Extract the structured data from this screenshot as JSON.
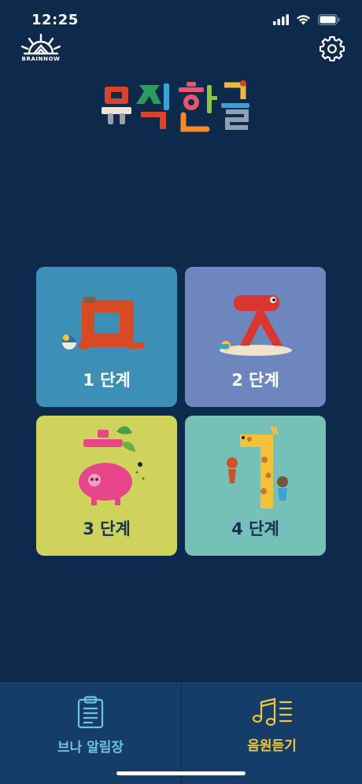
{
  "status_bar": {
    "time": "12:25",
    "icons": [
      "signal-icon",
      "wifi-icon",
      "battery-icon"
    ]
  },
  "header": {
    "brand_name": "BRAINNOW",
    "settings_icon": "gear-icon"
  },
  "app_logo": {
    "title": "뮤직한글",
    "letters": [
      {
        "char": "뮤",
        "color": "#d9432b"
      },
      {
        "char": "직",
        "color": "#2d9a5f"
      },
      {
        "char": "한",
        "color": "#e8566e"
      },
      {
        "char": "글",
        "color": "#f1b93a"
      }
    ]
  },
  "levels": [
    {
      "label": "1 단계",
      "color": "#3e8fb6",
      "art_letter": "ㅁ"
    },
    {
      "label": "2 단계",
      "color": "#6e86be",
      "art_letter": "ㅈ"
    },
    {
      "label": "3 단계",
      "color": "#cdd35b",
      "art_letter": "ㅎ"
    },
    {
      "label": "4 단계",
      "color": "#77c0b8",
      "art_letter": "ㄱ"
    }
  ],
  "tabbar": {
    "tabs": [
      {
        "label": "브나 알림장",
        "icon": "clipboard-icon",
        "color": "#6cc4dc"
      },
      {
        "label": "음원듣기",
        "icon": "music-notes-icon",
        "color": "#f0c63a"
      }
    ]
  }
}
